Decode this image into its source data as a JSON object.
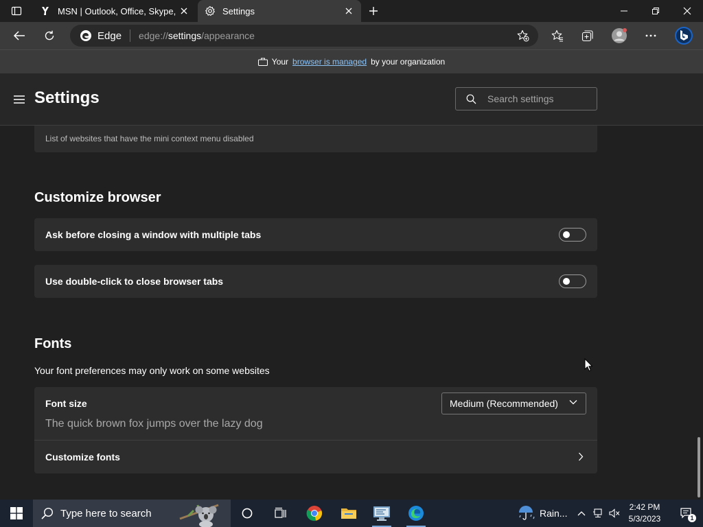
{
  "tabs": [
    {
      "title": "MSN | Outlook, Office, Skype, Bing",
      "active": false
    },
    {
      "title": "Settings",
      "active": true
    }
  ],
  "new_tab_label": "+",
  "address_bar": {
    "chip_label": "Edge",
    "url_prefix": "edge://",
    "url_host": "settings",
    "url_path": "/appearance"
  },
  "banner": {
    "prefix": "Your",
    "link": "browser is managed",
    "suffix": "by your organization"
  },
  "settings": {
    "title": "Settings",
    "search_placeholder": "Search settings"
  },
  "content": {
    "mini_menu_caption": "List of websites that have the mini context menu disabled",
    "customize_title": "Customize browser",
    "ask_before_closing": "Ask before closing a window with multiple tabs",
    "ask_before_closing_on": false,
    "double_click_close": "Use double-click to close browser tabs",
    "double_click_close_on": false,
    "fonts_title": "Fonts",
    "fonts_desc": "Your font preferences may only work on some websites",
    "font_size_label": "Font size",
    "font_size_value": "Medium (Recommended)",
    "font_preview": "The quick brown fox jumps over the lazy dog",
    "customize_fonts": "Customize fonts"
  },
  "taskbar": {
    "search_placeholder": "Type here to search",
    "weather": "Rain...",
    "time": "2:42 PM",
    "date": "5/3/2023",
    "notification_count": "1"
  },
  "colors": {
    "accent_link": "#8cc3f7",
    "taskbar_bg": "#1c2330"
  }
}
